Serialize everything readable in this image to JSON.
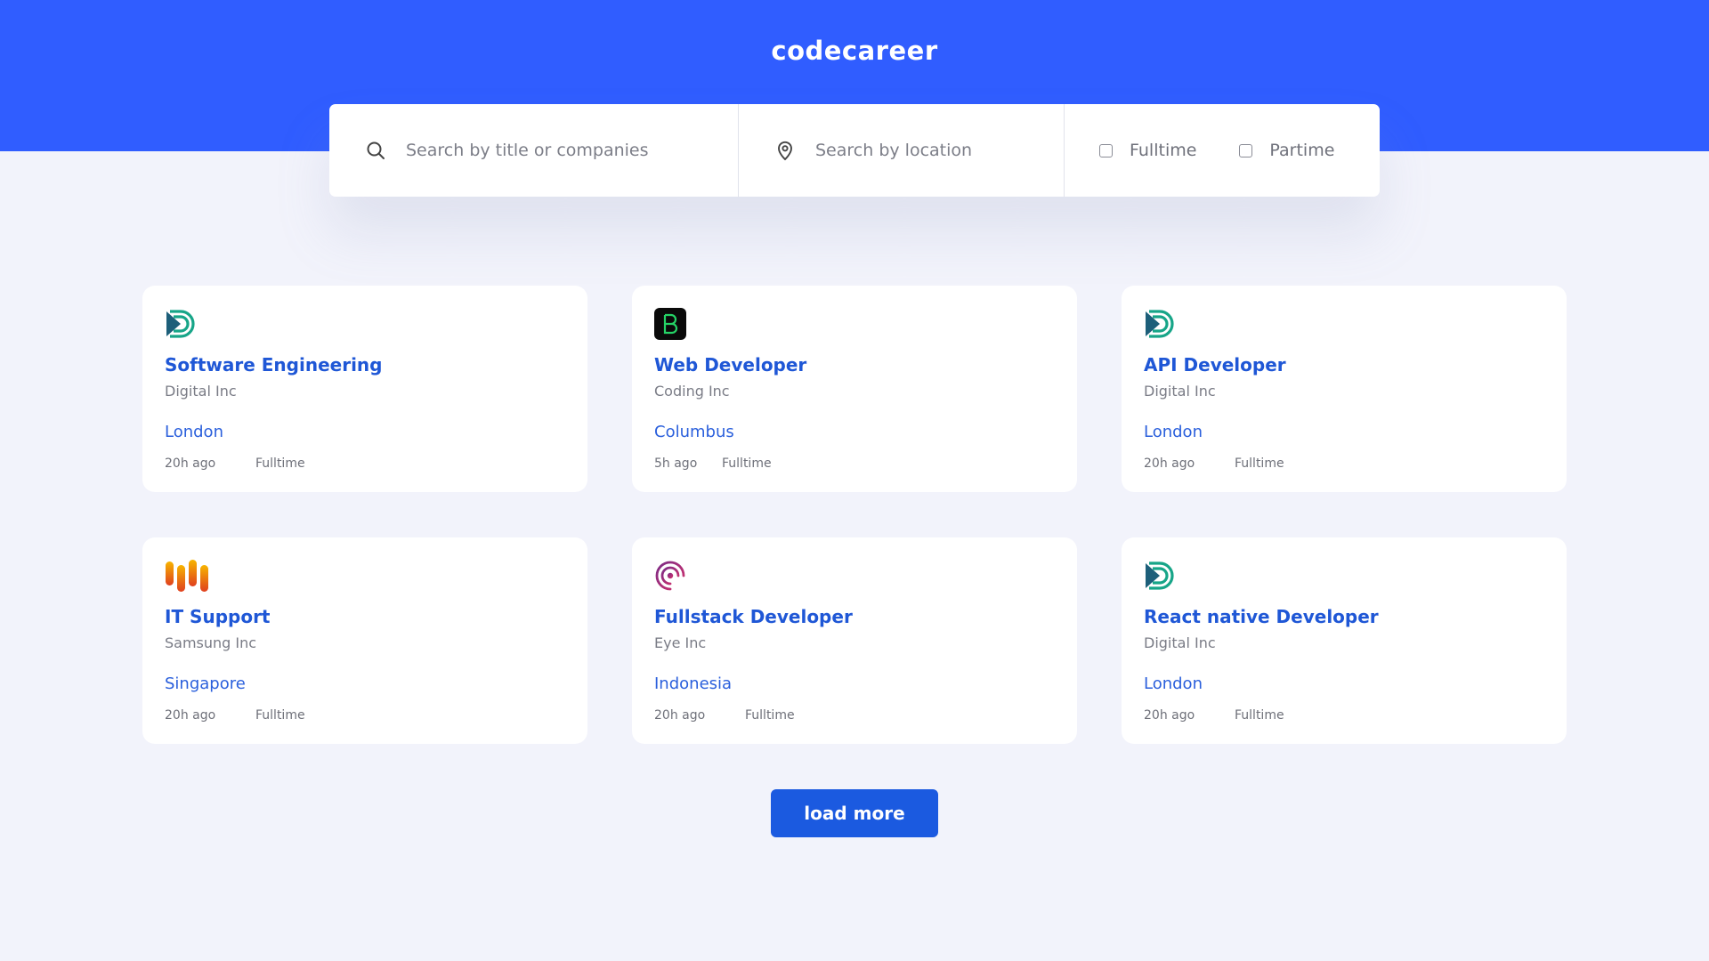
{
  "header": {
    "brand": "codecareer",
    "background": "#305dff"
  },
  "search": {
    "title_placeholder": "Search by title or companies",
    "location_placeholder": "Search by location",
    "options": [
      {
        "label": "Fulltime",
        "checked": false
      },
      {
        "label": "Partime",
        "checked": false
      }
    ]
  },
  "jobs": [
    {
      "logo": "digital-logo-icon",
      "title": "Software Engineering",
      "company": "Digital Inc",
      "location": "London",
      "posted": "20h ago",
      "type": "Fulltime"
    },
    {
      "logo": "coding-logo-icon",
      "title": "Web Developer",
      "company": "Coding Inc",
      "location": "Columbus",
      "posted": "5h ago",
      "type": "Fulltime"
    },
    {
      "logo": "digital-logo-icon",
      "title": "API Developer",
      "company": "Digital Inc",
      "location": "London",
      "posted": "20h ago",
      "type": "Fulltime"
    },
    {
      "logo": "samsung-logo-icon",
      "title": "IT Support",
      "company": "Samsung Inc",
      "location": "Singapore",
      "posted": "20h ago",
      "type": "Fulltime"
    },
    {
      "logo": "eye-logo-icon",
      "title": "Fullstack Developer",
      "company": "Eye Inc",
      "location": "Indonesia",
      "posted": "20h ago",
      "type": "Fulltime"
    },
    {
      "logo": "digital-logo-icon",
      "title": "React native Developer",
      "company": "Digital Inc",
      "location": "London",
      "posted": "20h ago",
      "type": "Fulltime"
    }
  ],
  "actions": {
    "load_more_label": "load more",
    "accent": "#1b5ae0"
  }
}
